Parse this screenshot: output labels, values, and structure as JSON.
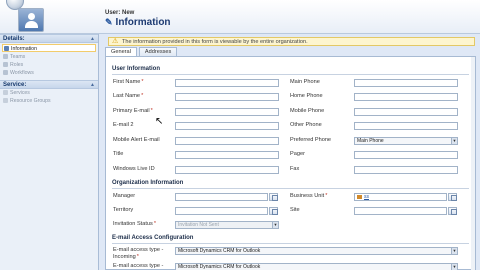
{
  "header": {
    "entity_label": "User: New",
    "form_title": "Information",
    "record_icon": "user-icon"
  },
  "nav": {
    "details_label": "Details:",
    "details_items": [
      {
        "label": "Information",
        "icon": "info-icon",
        "active": true
      },
      {
        "label": "Teams",
        "icon": "teams-icon",
        "active": false
      },
      {
        "label": "Roles",
        "icon": "roles-icon",
        "active": false
      },
      {
        "label": "Workflows",
        "icon": "workflow-icon",
        "active": false
      }
    ],
    "service_label": "Service:",
    "service_items": [
      {
        "label": "Services",
        "icon": "services-icon"
      },
      {
        "label": "Resource Groups",
        "icon": "resource-groups-icon"
      }
    ]
  },
  "notice": {
    "text": "The information provided in this form is viewable by the entire organization."
  },
  "tabs": [
    {
      "label": "General",
      "active": true
    },
    {
      "label": "Addresses",
      "active": false
    }
  ],
  "user_info": {
    "title": "User Information",
    "first_name": "First Name",
    "last_name": "Last Name",
    "primary_email": "Primary E-mail",
    "email2": "E-mail 2",
    "mobile_alert_email": "Mobile Alert E-mail",
    "title_label": "Title",
    "windows_live_id": "Windows Live ID",
    "main_phone": "Main Phone",
    "home_phone": "Home Phone",
    "mobile_phone": "Mobile Phone",
    "other_phone": "Other Phone",
    "preferred_phone": "Preferred Phone",
    "preferred_phone_value": "Main Phone",
    "pager": "Pager",
    "fax": "Fax"
  },
  "org_info": {
    "title": "Organization Information",
    "manager": "Manager",
    "territory": "Territory",
    "invitation_status": "Invitation Status",
    "invitation_status_value": "Invitation Not Sent",
    "business_unit": "Business Unit",
    "business_unit_value": "ss",
    "site": "Site"
  },
  "email_config": {
    "title": "E-mail Access Configuration",
    "incoming_label_1": "E-mail access type -",
    "incoming_label_2": "Incoming",
    "incoming_value": "Microsoft Dynamics CRM for Outlook",
    "outgoing_label": "E-mail access type -",
    "outgoing_value": "Microsoft Dynamics CRM for Outlook"
  },
  "required_mark": "*",
  "colors": {
    "title_blue": "#1d3b72",
    "nav_bg": "#eaf0f8",
    "notice_bg": "#fdf5cf",
    "required_red": "#c0392b"
  }
}
